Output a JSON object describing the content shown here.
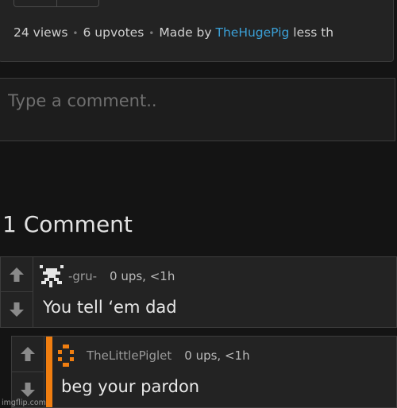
{
  "post_stats": {
    "views": "24 views",
    "upvotes": "6 upvotes",
    "made_by": "Made by",
    "author": "TheHugePig",
    "time": "less than"
  },
  "comment_input": {
    "placeholder": "Type a comment.."
  },
  "comments_count": "1 Comment",
  "comments": [
    {
      "username": "-gru-",
      "meta": "0 ups, <1h",
      "text": "You tell ‘em dad",
      "avatar_icon": "pixel-figure-avatar-icon"
    },
    {
      "username": "TheLittlePiglet",
      "meta": "0 ups, <1h",
      "text": "beg your pardon",
      "avatar_icon": "orange-pixel-avatar-icon",
      "accent_color": "#f07e10"
    }
  ],
  "watermark": "imgflip.com",
  "colors": {
    "link": "#3ba0d7",
    "reply_accent": "#f07e10",
    "background": "#141414"
  }
}
